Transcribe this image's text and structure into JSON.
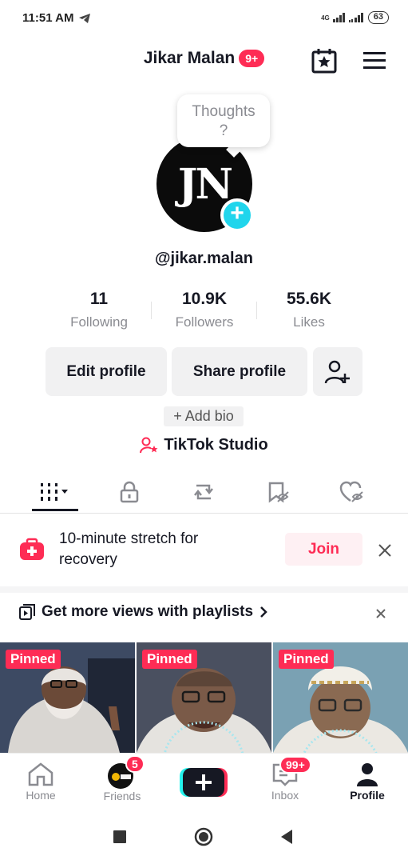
{
  "status_bar": {
    "time": "11:51 AM",
    "network": "4G",
    "battery": "63"
  },
  "header": {
    "username": "Jikar Malan",
    "notification_badge": "9+"
  },
  "profile": {
    "thought_bubble": "Thoughts\n?",
    "avatar_initials": "JN",
    "handle": "@jikar.malan",
    "stats": [
      {
        "value": "11",
        "label": "Following"
      },
      {
        "value": "10.9K",
        "label": "Followers"
      },
      {
        "value": "55.6K",
        "label": "Likes"
      }
    ],
    "edit_profile_label": "Edit profile",
    "share_profile_label": "Share profile",
    "add_bio_label": "+ Add bio",
    "studio_label": "TikTok Studio"
  },
  "tabs": [
    {
      "icon": "videos-grid-icon"
    },
    {
      "icon": "lock-icon"
    },
    {
      "icon": "repost-icon"
    },
    {
      "icon": "favorites-icon"
    },
    {
      "icon": "liked-icon"
    }
  ],
  "promo": {
    "text": "10-minute stretch for recovery",
    "join_label": "Join"
  },
  "playlist_banner": {
    "text": "Get more views with playlists"
  },
  "videos": [
    {
      "pinned_label": "Pinned"
    },
    {
      "pinned_label": "Pinned"
    },
    {
      "pinned_label": "Pinned"
    }
  ],
  "bottom_nav": {
    "home": "Home",
    "friends": "Friends",
    "friends_badge": "5",
    "inbox": "Inbox",
    "inbox_badge": "99+",
    "profile": "Profile"
  },
  "colors": {
    "accent": "#fe2c55",
    "cyan": "#20d5ec",
    "text": "#161823",
    "muted": "#8a8b91"
  }
}
